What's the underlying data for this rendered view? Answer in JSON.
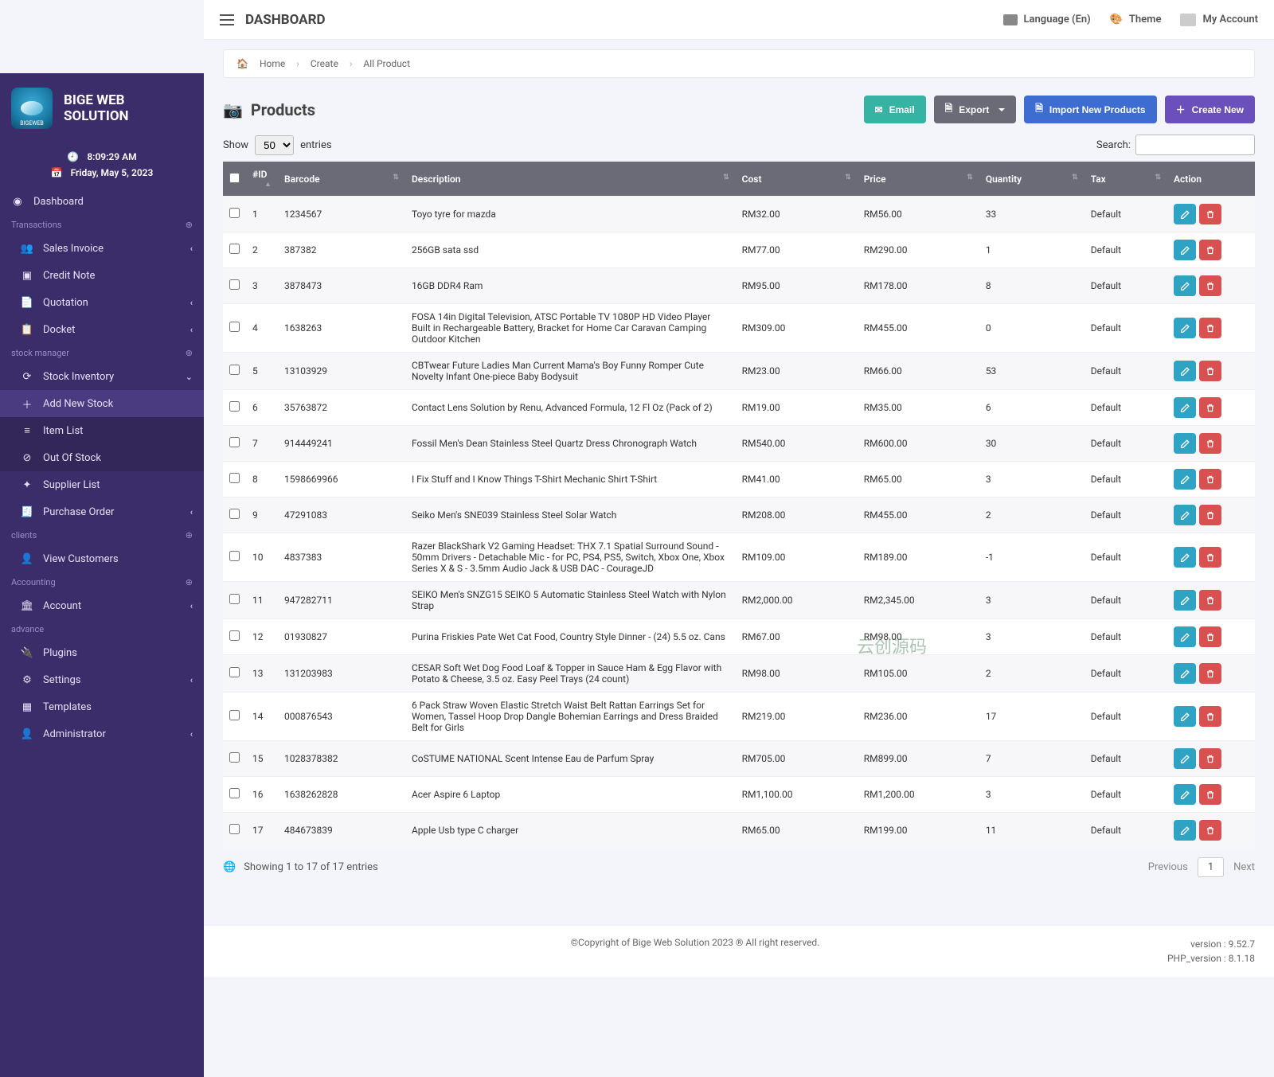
{
  "topbar": {
    "title": "DASHBOARD",
    "language": "Language (En)",
    "theme": "Theme",
    "account": "My Account"
  },
  "brand": {
    "line1": "BIGE WEB",
    "line2": "SOLUTION"
  },
  "clock": {
    "time": "8:09:29 AM",
    "date": "Friday, May 5, 2023"
  },
  "sidebar": {
    "dashboard": "Dashboard",
    "sections": {
      "transactions": "Transactions",
      "stock_manager": "stock manager",
      "clients": "clients",
      "accounting": "Accounting",
      "advance": "advance"
    },
    "items": {
      "sales_invoice": "Sales Invoice",
      "credit_note": "Credit Note",
      "quotation": "Quotation",
      "docket": "Docket",
      "stock_inventory": "Stock Inventory",
      "add_new_stock": "Add New Stock",
      "item_list": "Item List",
      "out_of_stock": "Out Of Stock",
      "supplier_list": "Supplier List",
      "purchase_order": "Purchase Order",
      "view_customers": "View Customers",
      "account_item": "Account",
      "plugins": "Plugins",
      "settings": "Settings",
      "templates": "Templates",
      "administrator": "Administrator"
    }
  },
  "breadcrumb": {
    "home": "Home",
    "create": "Create",
    "all_product": "All Product"
  },
  "page": {
    "title": "Products",
    "email": "Email",
    "export": "Export",
    "import": "Import New Products",
    "create_new": "Create New"
  },
  "table_controls": {
    "show": "Show",
    "entries": "entries",
    "entries_value": "50",
    "search_label": "Search:"
  },
  "columns": {
    "id": "#ID",
    "barcode": "Barcode",
    "description": "Description",
    "cost": "Cost",
    "price": "Price",
    "quantity": "Quantity",
    "tax": "Tax",
    "action": "Action"
  },
  "rows": [
    {
      "id": "1",
      "barcode": "1234567",
      "desc": "Toyo tyre for mazda",
      "cost": "RM32.00",
      "price": "RM56.00",
      "qty": "33",
      "tax": "Default"
    },
    {
      "id": "2",
      "barcode": "387382",
      "desc": "256GB sata ssd",
      "cost": "RM77.00",
      "price": "RM290.00",
      "qty": "1",
      "tax": "Default"
    },
    {
      "id": "3",
      "barcode": "3878473",
      "desc": "16GB DDR4 Ram",
      "cost": "RM95.00",
      "price": "RM178.00",
      "qty": "8",
      "tax": "Default"
    },
    {
      "id": "4",
      "barcode": "1638263",
      "desc": "FOSA 14in Digital Television, ATSC Portable TV 1080P HD Video Player Built in Rechargeable Battery, Bracket for Home Car Caravan Camping Outdoor Kitchen",
      "cost": "RM309.00",
      "price": "RM455.00",
      "qty": "0",
      "tax": "Default"
    },
    {
      "id": "5",
      "barcode": "13103929",
      "desc": "CBTwear Future Ladies Man Current Mama's Boy Funny Romper Cute Novelty Infant One-piece Baby Bodysuit",
      "cost": "RM23.00",
      "price": "RM66.00",
      "qty": "53",
      "tax": "Default"
    },
    {
      "id": "6",
      "barcode": "35763872",
      "desc": "Contact Lens Solution by Renu, Advanced Formula, 12 Fl Oz (Pack of 2)",
      "cost": "RM19.00",
      "price": "RM35.00",
      "qty": "6",
      "tax": "Default"
    },
    {
      "id": "7",
      "barcode": "914449241",
      "desc": "Fossil Men's Dean Stainless Steel Quartz Dress Chronograph Watch",
      "cost": "RM540.00",
      "price": "RM600.00",
      "qty": "30",
      "tax": "Default"
    },
    {
      "id": "8",
      "barcode": "1598669966",
      "desc": "I Fix Stuff and I Know Things T-Shirt Mechanic Shirt T-Shirt",
      "cost": "RM41.00",
      "price": "RM65.00",
      "qty": "3",
      "tax": "Default"
    },
    {
      "id": "9",
      "barcode": "47291083",
      "desc": "Seiko Men's SNE039 Stainless Steel Solar Watch",
      "cost": "RM208.00",
      "price": "RM455.00",
      "qty": "2",
      "tax": "Default"
    },
    {
      "id": "10",
      "barcode": "4837383",
      "desc": "Razer BlackShark V2 Gaming Headset: THX 7.1 Spatial Surround Sound - 50mm Drivers - Detachable Mic - for PC, PS4, PS5, Switch, Xbox One, Xbox Series X & S - 3.5mm Audio Jack & USB DAC - CourageJD",
      "cost": "RM109.00",
      "price": "RM189.00",
      "qty": "-1",
      "tax": "Default"
    },
    {
      "id": "11",
      "barcode": "947282711",
      "desc": "SEIKO Men's SNZG15 SEIKO 5 Automatic Stainless Steel Watch with Nylon Strap",
      "cost": "RM2,000.00",
      "price": "RM2,345.00",
      "qty": "3",
      "tax": "Default"
    },
    {
      "id": "12",
      "barcode": "01930827",
      "desc": "Purina Friskies Pate Wet Cat Food, Country Style Dinner - (24) 5.5 oz. Cans",
      "cost": "RM67.00",
      "price": "RM98.00",
      "qty": "3",
      "tax": "Default"
    },
    {
      "id": "13",
      "barcode": "131203983",
      "desc": "CESAR Soft Wet Dog Food Loaf & Topper in Sauce Ham & Egg Flavor with Potato & Cheese, 3.5 oz. Easy Peel Trays (24 count)",
      "cost": "RM98.00",
      "price": "RM105.00",
      "qty": "2",
      "tax": "Default"
    },
    {
      "id": "14",
      "barcode": "000876543",
      "desc": "6 Pack Straw Woven Elastic Stretch Waist Belt Rattan Earrings Set for Women, Tassel Hoop Drop Dangle Bohemian Earrings and Dress Braided Belt for Girls",
      "cost": "RM219.00",
      "price": "RM236.00",
      "qty": "17",
      "tax": "Default"
    },
    {
      "id": "15",
      "barcode": "1028378382",
      "desc": "CoSTUME NATIONAL Scent Intense Eau de Parfum Spray",
      "cost": "RM705.00",
      "price": "RM899.00",
      "qty": "7",
      "tax": "Default"
    },
    {
      "id": "16",
      "barcode": "1638262828",
      "desc": "Acer Aspire 6 Laptop",
      "cost": "RM1,100.00",
      "price": "RM1,200.00",
      "qty": "3",
      "tax": "Default"
    },
    {
      "id": "17",
      "barcode": "484673839",
      "desc": "Apple Usb type C charger",
      "cost": "RM65.00",
      "price": "RM199.00",
      "qty": "11",
      "tax": "Default"
    }
  ],
  "table_footer": {
    "info": "Showing 1 to 17 of 17 entries",
    "previous": "Previous",
    "next": "Next",
    "page": "1"
  },
  "footer": {
    "copyright": "©Copyright of Bige Web Solution 2023    ® All right reserved.",
    "version": "version : 9.52.7",
    "php": "PHP_version : 8.1.18"
  },
  "watermark": "云创源码"
}
